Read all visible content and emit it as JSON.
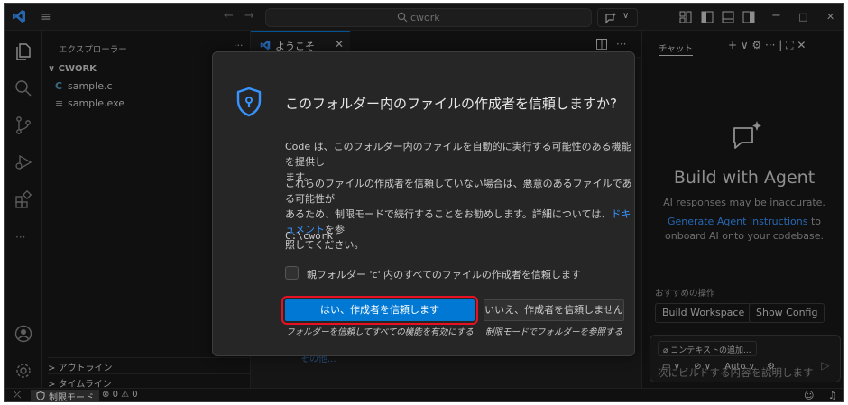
{
  "titlebar": {
    "search_text": "cwork",
    "nav_back": "←",
    "nav_forward": "→",
    "menu_glyph": "≡",
    "min_glyph": "−",
    "max_glyph": "□",
    "close_glyph": "✕"
  },
  "sidebar": {
    "title": "エクスプローラー",
    "more": "···",
    "folder": "CWORK",
    "files": [
      {
        "icon": "C",
        "name": "sample.c"
      },
      {
        "icon": "≡",
        "name": "sample.exe"
      }
    ],
    "sections": [
      "アウトライン",
      "タイムライン"
    ]
  },
  "editor": {
    "tab_label": "ようこそ",
    "tab_close": "✕",
    "more": "···",
    "faint_text": "その他..."
  },
  "dialog": {
    "title": "このフォルダー内のファイルの作成者を信頼しますか?",
    "message1_line1": "Code は、このフォルダー内のファイルを自動的に実行する可能性のある機能を提供し",
    "message1_line2": "ます。",
    "message2_line1": "これらのファイルの作成者を信頼していない場合は、悪意のあるファイルである可能性が",
    "message2_line2_pre": "あるため、制限モードで続行することをお勧めします。詳細については、",
    "message2_link": "ドキュメント",
    "message2_line2_post": "を参",
    "message2_line3": "照してください。",
    "path": "C:\\cwork",
    "checkbox_label": "親フォルダー 'c' 内のすべてのファイルの作成者を信頼します",
    "primary_button": "はい、作成者を信頼します",
    "primary_desc": "フォルダーを信頼してすべての機能を有効にする",
    "secondary_button": "いいえ、作成者を信頼しません",
    "secondary_desc": "制限モードでフォルダーを参照する"
  },
  "chat": {
    "tab": "チャット",
    "tools": "+ ∨ ⚙ ··· | ⛶ ✕",
    "title": "Build with Agent",
    "sub1": "AI responses may be inaccurate.",
    "link": "Generate Agent Instructions",
    "sub2_post": " to",
    "sub3": "onboard AI onto your codebase.",
    "suggest_label": "おすすめの操作",
    "suggest_buttons": [
      "Build Workspace",
      "Show Config"
    ],
    "context_button": "コンテキストの追加...",
    "input_placeholder": "次にビルドする内容を説明します",
    "mode": "Auto",
    "send_glyph": "▷"
  },
  "statusbar": {
    "remote": "⤫",
    "restricted": "制限モード",
    "errors": "0",
    "warnings": "0"
  },
  "colors": {
    "accent": "#0078d4",
    "highlight_border": "#e81123",
    "link": "#3794ff"
  }
}
